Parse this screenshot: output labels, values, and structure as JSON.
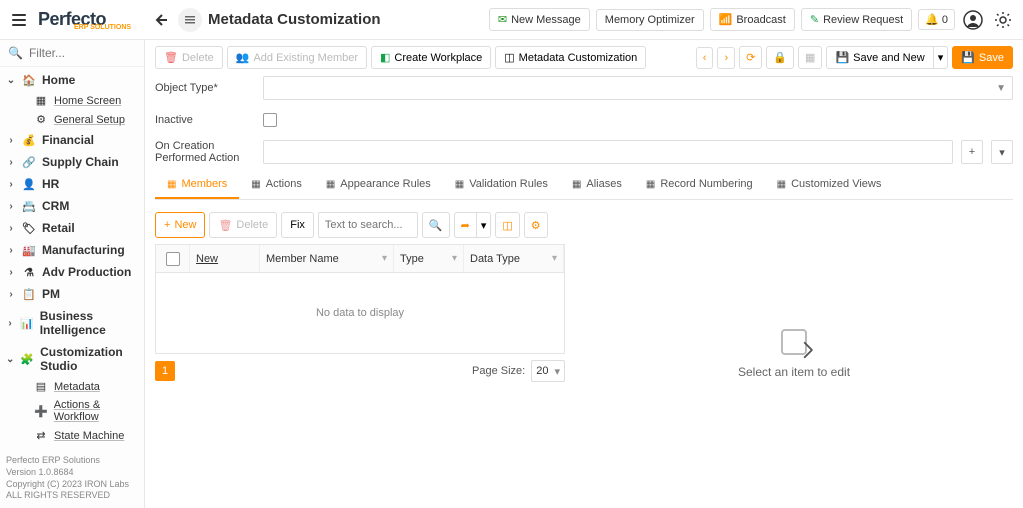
{
  "app": {
    "logo": "Perfecto",
    "logo_sub": "ERP SOLUTIONS",
    "page_title": "Metadata Customization"
  },
  "top_buttons": {
    "new_message": "New Message",
    "memory_optimizer": "Memory Optimizer",
    "broadcast": "Broadcast",
    "review_request": "Review Request",
    "notif_count": "0"
  },
  "sidebar": {
    "search_placeholder": "Filter...",
    "groups": [
      {
        "label": "Home",
        "expanded": true,
        "icon": "🏠",
        "children": [
          {
            "label": "Home Screen",
            "icon": "▦"
          },
          {
            "label": "General Setup",
            "icon": "⚙"
          }
        ]
      },
      {
        "label": "Financial",
        "icon": "💰"
      },
      {
        "label": "Supply Chain",
        "icon": "🔗"
      },
      {
        "label": "HR",
        "icon": "👤"
      },
      {
        "label": "CRM",
        "icon": "📇"
      },
      {
        "label": "Retail",
        "icon": "🏷"
      },
      {
        "label": "Manufacturing",
        "icon": "🏭"
      },
      {
        "label": "Adv Production",
        "icon": "⚗"
      },
      {
        "label": "PM",
        "icon": "📋"
      },
      {
        "label": "Business Intelligence",
        "icon": "📊"
      },
      {
        "label": "Customization Studio",
        "expanded": true,
        "icon": "🧩",
        "children": [
          {
            "label": "Metadata",
            "icon": "▤"
          },
          {
            "label": "Actions & Workflow",
            "icon": "➕"
          },
          {
            "label": "State Machine",
            "icon": "⇄"
          }
        ]
      }
    ],
    "footer": {
      "l1": "Perfecto ERP Solutions",
      "l2": "Version 1.0.8684",
      "l3": "Copyright (C) 2023 IRON Labs ALL RIGHTS RESERVED"
    }
  },
  "toolbar": {
    "delete": "Delete",
    "add_existing": "Add Existing Member",
    "create_workplace": "Create Workplace",
    "metadata_customization": "Metadata Customization",
    "save_and_new": "Save and New",
    "save": "Save"
  },
  "form": {
    "object_type_label": "Object Type*",
    "inactive_label": "Inactive",
    "on_creation_label": "On Creation Performed Action"
  },
  "tabs": [
    {
      "label": "Members",
      "active": true
    },
    {
      "label": "Actions"
    },
    {
      "label": "Appearance Rules"
    },
    {
      "label": "Validation Rules"
    },
    {
      "label": "Aliases"
    },
    {
      "label": "Record Numbering"
    },
    {
      "label": "Customized Views"
    }
  ],
  "grid": {
    "new_btn": "New",
    "delete_btn": "Delete",
    "fix_btn": "Fix",
    "search_placeholder": "Text to search...",
    "columns": {
      "c1": "New",
      "c2": "Member Name",
      "c3": "Type",
      "c4": "Data Type"
    },
    "empty_text": "No data to display",
    "page": "1",
    "page_size_label": "Page Size:",
    "page_size_value": "20"
  },
  "detail": {
    "placeholder": "Select an item to edit"
  }
}
